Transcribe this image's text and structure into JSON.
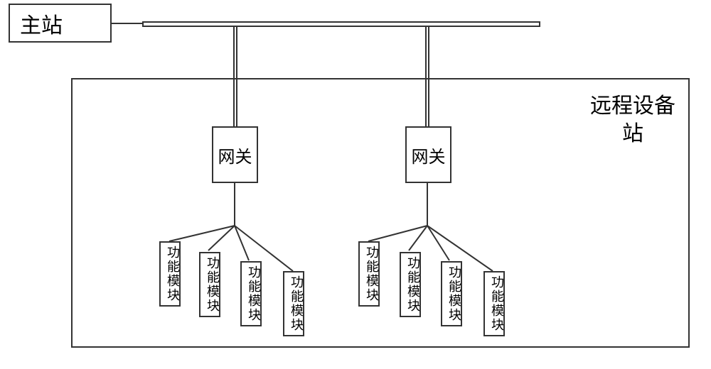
{
  "chart_data": {
    "type": "diagram",
    "title": "",
    "nodes": {
      "main_station": "主站",
      "remote_station": "远程设备站",
      "gateway": "网关",
      "function_module": "功能模块"
    },
    "structure": {
      "main_station_connects_to": "bus",
      "bus_connects_to": [
        "gateway_1",
        "gateway_2"
      ],
      "remote_station_contains": [
        "gateway_1",
        "gateway_2"
      ],
      "gateway_1_modules_count": 4,
      "gateway_2_modules_count": 4
    }
  },
  "main_station_label": "主站",
  "remote_station_label": "远程设备站",
  "gateway1_label": "网关",
  "gateway2_label": "网关",
  "modules_g1": [
    "功能模块",
    "功能模块",
    "功能模块",
    "功能模块"
  ],
  "modules_g2": [
    "功能模块",
    "功能模块",
    "功能模块",
    "功能模块"
  ]
}
